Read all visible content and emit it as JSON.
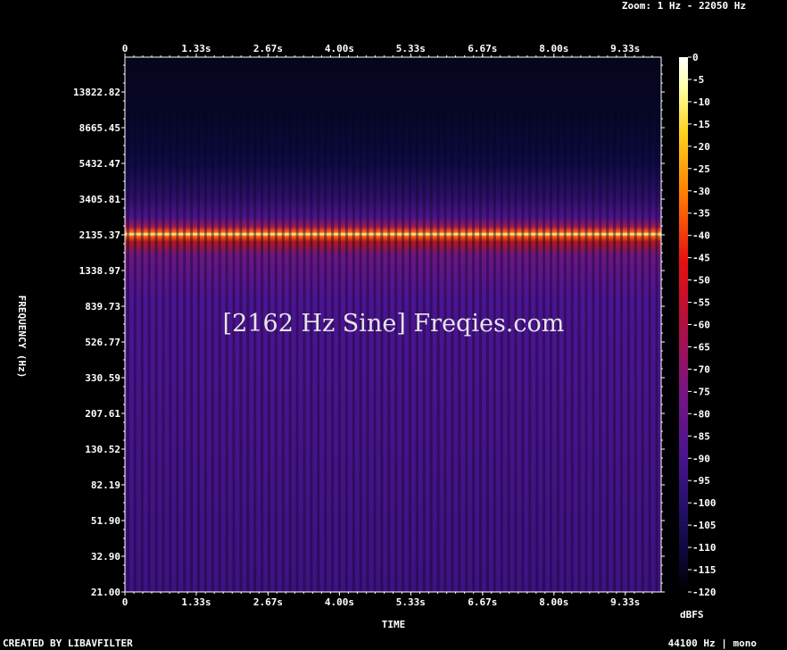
{
  "header": {
    "zoom_label": "Zoom: 1 Hz - 22050 Hz"
  },
  "footer": {
    "left_text": "CREATED BY LIBAVFILTER",
    "right_text": "44100 Hz | mono"
  },
  "watermark": "[2162 Hz Sine] Freqies.com",
  "chart_data": {
    "type": "heatmap",
    "title": "",
    "xlabel": "TIME",
    "ylabel": "FREQUENCY (Hz)",
    "x_ticks": [
      "0",
      "1.33s",
      "2.67s",
      "4.00s",
      "5.33s",
      "6.67s",
      "8.00s",
      "9.33s"
    ],
    "x_tick_values": [
      0,
      1.33,
      2.67,
      4.0,
      5.33,
      6.67,
      8.0,
      9.33
    ],
    "xlim": [
      0,
      10
    ],
    "y_ticks": [
      "21.00",
      "32.90",
      "51.90",
      "82.19",
      "130.52",
      "207.61",
      "330.59",
      "526.77",
      "839.73",
      "1338.97",
      "2135.37",
      "3405.81",
      "5432.47",
      "8665.45",
      "13822.82"
    ],
    "ylim": [
      21,
      22050
    ],
    "y_scale": "log",
    "colorbar": {
      "label": "dBFS",
      "ticks": [
        "0",
        "-5",
        "-10",
        "-15",
        "-20",
        "-25",
        "-30",
        "-35",
        "-40",
        "-45",
        "-50",
        "-55",
        "-60",
        "-65",
        "-70",
        "-75",
        "-80",
        "-85",
        "-90",
        "-95",
        "-100",
        "-105",
        "-110",
        "-115",
        "-120"
      ],
      "range": [
        -120,
        0
      ]
    },
    "signal": {
      "frequency_hz": 2162,
      "level_dbfs": 0
    },
    "colors": {
      "background": "#000000",
      "axis": "#ffffff"
    }
  }
}
